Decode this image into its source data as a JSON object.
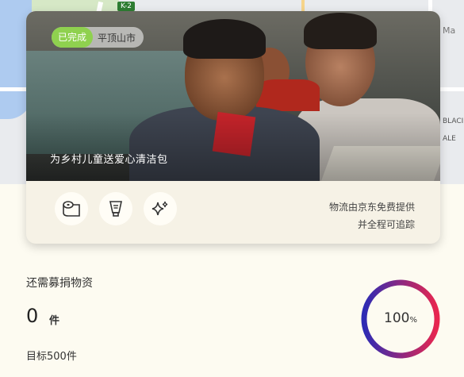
{
  "map": {
    "road_badge": "K-2",
    "side_labels": [
      "Ma",
      "BLACI",
      "ALE"
    ]
  },
  "card": {
    "status_tag": "已完成",
    "location": "平顶山市",
    "caption": "为乡村儿童送爱心清洁包",
    "icons": [
      "toilet-paper-icon",
      "toothpaste-icon",
      "sparkle-icon"
    ],
    "logistics_line1": "物流由京东免费提供",
    "logistics_line2": "并全程可追踪"
  },
  "stats": {
    "need_label": "还需募捐物资",
    "remaining_count": "0",
    "unit": "件",
    "target_label": "目标500件",
    "progress_percent": 100,
    "progress_number": "100",
    "progress_symbol": "%",
    "ring_colors": [
      "#2d2bb4",
      "#e8264f"
    ]
  }
}
